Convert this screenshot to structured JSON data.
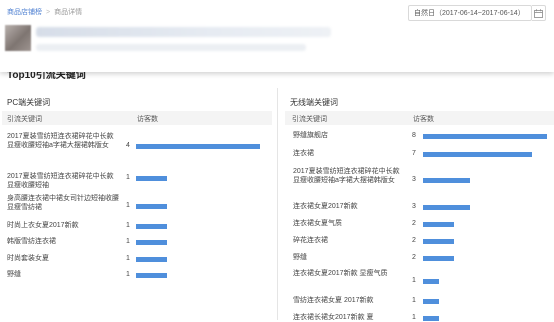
{
  "breadcrumb": {
    "parent": "商品店铺榜",
    "separator": ">",
    "current": "商品详情"
  },
  "date_range": {
    "label": "自然日（2017-06-14~2017-06-14）"
  },
  "section_title": "Top10引流关键词",
  "pc": {
    "title": "PC端关键词",
    "col_keyword": "引流关键词",
    "col_visitors": "访客数",
    "rows": [
      {
        "keyword": "2017夏装雪纺短连衣裙碎花中长款显瘦收腰短袖a字裙大摆裙韩版女",
        "visitors": 4
      },
      {
        "keyword": "2017夏装雪纺短连衣裙碎花中长款显瘦收腰短袖",
        "visitors": 1
      },
      {
        "keyword": "身高腰连衣裙中裙女司针边短袖收腰显瘦雪纺裙",
        "visitors": 1
      },
      {
        "keyword": "时尚上衣女夏2017新款",
        "visitors": 1
      },
      {
        "keyword": "韩版雪纺连衣裙",
        "visitors": 1
      },
      {
        "keyword": "时尚套装女夏",
        "visitors": 1
      },
      {
        "keyword": "野缝",
        "visitors": 1
      }
    ]
  },
  "mobile": {
    "title": "无线端关键词",
    "col_keyword": "引流关键词",
    "col_visitors": "访客数",
    "rows": [
      {
        "keyword": "野缝旗舰店",
        "visitors": 8
      },
      {
        "keyword": "连衣裙",
        "visitors": 7
      },
      {
        "keyword": "2017夏装雪纺短连衣裙碎花中长款显瘦收腰短袖a字裙大摆裙韩版女",
        "visitors": 3
      },
      {
        "keyword": "连衣裙女夏2017新款",
        "visitors": 3
      },
      {
        "keyword": "连衣裙女夏气质",
        "visitors": 2
      },
      {
        "keyword": "碎花连衣裙",
        "visitors": 2
      },
      {
        "keyword": "野缝",
        "visitors": 2
      },
      {
        "keyword": "连衣裙女夏2017新款 显瘦气质",
        "visitors": 1
      },
      {
        "keyword": "雪纺连衣裙女夏 2017新款",
        "visitors": 1
      },
      {
        "keyword": "连衣裙长裙女2017新款 夏",
        "visitors": 1
      }
    ]
  },
  "colors": {
    "bar": "#4f8fdc",
    "link": "#4d7fd1"
  },
  "icons": {
    "calendar": "calendar-icon"
  }
}
